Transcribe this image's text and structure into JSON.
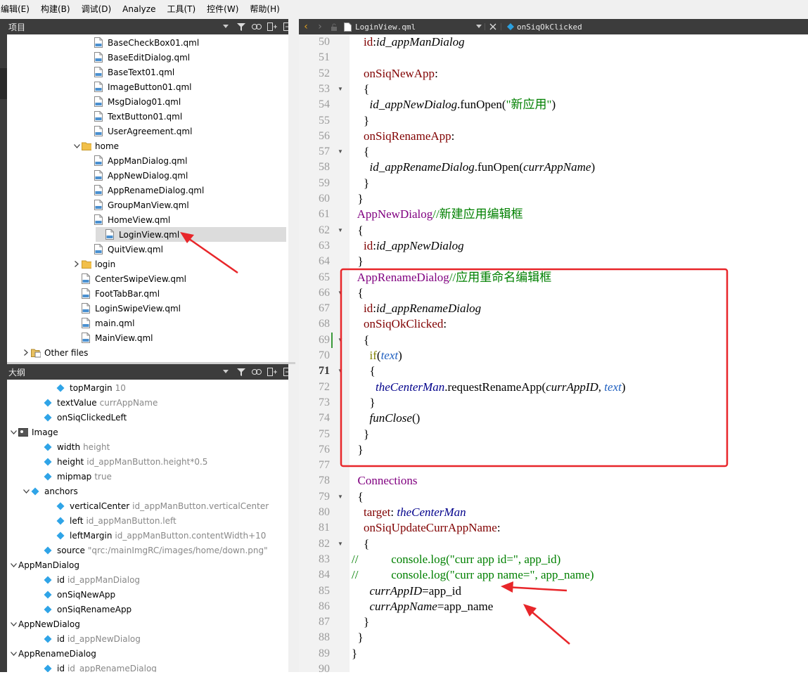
{
  "menu": [
    "编辑(E)",
    "构建(B)",
    "调试(D)",
    "Analyze",
    "工具(T)",
    "控件(W)",
    "帮助(H)"
  ],
  "project_panel": {
    "title": "项目",
    "rows": [
      {
        "indent": 6,
        "type": "qml",
        "label": "BaseCheckBox01.qml"
      },
      {
        "indent": 6,
        "type": "qml",
        "label": "BaseEditDialog.qml"
      },
      {
        "indent": 6,
        "type": "qml",
        "label": "BaseText01.qml"
      },
      {
        "indent": 6,
        "type": "qml",
        "label": "ImageButton01.qml"
      },
      {
        "indent": 6,
        "type": "qml",
        "label": "MsgDialog01.qml"
      },
      {
        "indent": 6,
        "type": "qml",
        "label": "TextButton01.qml"
      },
      {
        "indent": 6,
        "type": "qml",
        "label": "UserAgreement.qml"
      },
      {
        "indent": 5,
        "type": "folder",
        "arrow": "down",
        "label": "home"
      },
      {
        "indent": 6,
        "type": "qml",
        "label": "AppManDialog.qml"
      },
      {
        "indent": 6,
        "type": "qml",
        "label": "AppNewDialog.qml"
      },
      {
        "indent": 6,
        "type": "qml",
        "label": "AppRenameDialog.qml"
      },
      {
        "indent": 6,
        "type": "qml",
        "label": "GroupManView.qml"
      },
      {
        "indent": 6,
        "type": "qml",
        "label": "HomeView.qml"
      },
      {
        "indent": 6,
        "type": "qml",
        "label": "LoginView.qml",
        "selected": true
      },
      {
        "indent": 6,
        "type": "qml",
        "label": "QuitView.qml"
      },
      {
        "indent": 5,
        "type": "folder",
        "arrow": "right",
        "label": "login"
      },
      {
        "indent": 5,
        "type": "qml",
        "label": "CenterSwipeView.qml"
      },
      {
        "indent": 5,
        "type": "qml",
        "label": "FootTabBar.qml"
      },
      {
        "indent": 5,
        "type": "qml",
        "label": "LoginSwipeView.qml"
      },
      {
        "indent": 5,
        "type": "qml",
        "label": "main.qml"
      },
      {
        "indent": 5,
        "type": "qml",
        "label": "MainView.qml"
      },
      {
        "indent": 1,
        "type": "other",
        "arrow": "right",
        "label": "Other files"
      }
    ]
  },
  "outline_panel": {
    "title": "大纲",
    "rows": [
      {
        "indent": 3,
        "type": "prop",
        "label": "topMargin",
        "value": "10"
      },
      {
        "indent": 2,
        "type": "prop",
        "label": "textValue",
        "value": "currAppName"
      },
      {
        "indent": 2,
        "type": "prop",
        "label": "onSiqClickedLeft",
        "value": ""
      },
      {
        "indent": 0,
        "type": "image",
        "arrow": "down",
        "label": "Image",
        "value": ""
      },
      {
        "indent": 2,
        "type": "prop",
        "label": "width",
        "value": "height"
      },
      {
        "indent": 2,
        "type": "prop",
        "label": "height",
        "value": "id_appManButton.height*0.5"
      },
      {
        "indent": 2,
        "type": "prop",
        "label": "mipmap",
        "value": "true"
      },
      {
        "indent": 1,
        "type": "prop",
        "arrow": "down",
        "label": "anchors",
        "value": ""
      },
      {
        "indent": 3,
        "type": "prop",
        "label": "verticalCenter",
        "value": "id_appManButton.verticalCenter"
      },
      {
        "indent": 3,
        "type": "prop",
        "label": "left",
        "value": "id_appManButton.left"
      },
      {
        "indent": 3,
        "type": "prop",
        "label": "leftMargin",
        "value": "id_appManButton.contentWidth+10"
      },
      {
        "indent": 2,
        "type": "prop",
        "label": "source",
        "value": "\"qrc:/mainImgRC/images/home/down.png\""
      },
      {
        "indent": 0,
        "type": "none",
        "arrow": "down",
        "label": "AppManDialog",
        "value": ""
      },
      {
        "indent": 2,
        "type": "prop",
        "label": "id",
        "value": "id_appManDialog"
      },
      {
        "indent": 2,
        "type": "prop",
        "label": "onSiqNewApp",
        "value": ""
      },
      {
        "indent": 2,
        "type": "prop",
        "label": "onSiqRenameApp",
        "value": ""
      },
      {
        "indent": 0,
        "type": "none",
        "arrow": "down",
        "label": "AppNewDialog",
        "value": ""
      },
      {
        "indent": 2,
        "type": "prop",
        "label": "id",
        "value": "id_appNewDialog"
      },
      {
        "indent": 0,
        "type": "none",
        "arrow": "down",
        "label": "AppRenameDialog",
        "value": ""
      },
      {
        "indent": 2,
        "type": "prop",
        "label": "id",
        "value": "id_appRenameDialog"
      }
    ]
  },
  "editor": {
    "file_name": "LoginView.qml",
    "symbol": "onSiqOkClicked",
    "current_line": 71,
    "lines": [
      {
        "n": "50",
        "fold": "",
        "tokens": [
          [
            "",
            "    "
          ],
          [
            "pr",
            "id"
          ],
          [
            "",
            ":"
          ],
          [
            "it",
            "id_appManDialog"
          ]
        ]
      },
      {
        "n": "51",
        "fold": "",
        "tokens": []
      },
      {
        "n": "52",
        "fold": "",
        "tokens": [
          [
            "",
            "    "
          ],
          [
            "pr",
            "onSiqNewApp"
          ],
          [
            "",
            ":"
          ]
        ]
      },
      {
        "n": "53",
        "fold": "▼",
        "tokens": [
          [
            "",
            "    {"
          ]
        ]
      },
      {
        "n": "54",
        "fold": "",
        "tokens": [
          [
            "",
            "      "
          ],
          [
            "it",
            "id_appNewDialog"
          ],
          [
            "",
            ".funOpen("
          ],
          [
            "st",
            "\"新应用\""
          ],
          [
            "",
            ")"
          ]
        ]
      },
      {
        "n": "55",
        "fold": "",
        "tokens": [
          [
            "",
            "    }"
          ]
        ]
      },
      {
        "n": "56",
        "fold": "",
        "tokens": [
          [
            "",
            "    "
          ],
          [
            "pr",
            "onSiqRenameApp"
          ],
          [
            "",
            ":"
          ]
        ]
      },
      {
        "n": "57",
        "fold": "▼",
        "tokens": [
          [
            "",
            "    {"
          ]
        ]
      },
      {
        "n": "58",
        "fold": "",
        "tokens": [
          [
            "",
            "      "
          ],
          [
            "it",
            "id_appRenameDialog"
          ],
          [
            "",
            ".funOpen("
          ],
          [
            "it",
            "currAppName"
          ],
          [
            "",
            ")"
          ]
        ]
      },
      {
        "n": "59",
        "fold": "",
        "tokens": [
          [
            "",
            "    }"
          ]
        ]
      },
      {
        "n": "60",
        "fold": "",
        "tokens": [
          [
            "",
            "  }"
          ]
        ]
      },
      {
        "n": "61",
        "fold": "",
        "tokens": [
          [
            "",
            "  "
          ],
          [
            "kw",
            "AppNewDialog"
          ],
          [
            "cm",
            "//新建应用编辑框"
          ]
        ]
      },
      {
        "n": "62",
        "fold": "▼",
        "tokens": [
          [
            "",
            "  {"
          ]
        ]
      },
      {
        "n": "63",
        "fold": "",
        "tokens": [
          [
            "",
            "    "
          ],
          [
            "pr",
            "id"
          ],
          [
            "",
            ":"
          ],
          [
            "it",
            "id_appNewDialog"
          ]
        ]
      },
      {
        "n": "64",
        "fold": "",
        "tokens": [
          [
            "",
            "  }"
          ]
        ]
      },
      {
        "n": "65",
        "fold": "",
        "tokens": [
          [
            "",
            "  "
          ],
          [
            "kw",
            "AppRenameDialog"
          ],
          [
            "cm",
            "//应用重命名编辑框"
          ]
        ]
      },
      {
        "n": "66",
        "fold": "▼",
        "tokens": [
          [
            "",
            "  {"
          ]
        ]
      },
      {
        "n": "67",
        "fold": "",
        "tokens": [
          [
            "",
            "    "
          ],
          [
            "pr",
            "id"
          ],
          [
            "",
            ":"
          ],
          [
            "it",
            "id_appRenameDialog"
          ]
        ]
      },
      {
        "n": "68",
        "fold": "",
        "tokens": [
          [
            "",
            "    "
          ],
          [
            "pr",
            "onSiqOkClicked"
          ],
          [
            "",
            ":"
          ]
        ]
      },
      {
        "n": "69",
        "fold": "▼",
        "tokens": [
          [
            "",
            "    {"
          ]
        ]
      },
      {
        "n": "70",
        "fold": "",
        "tokens": [
          [
            "",
            "      "
          ],
          [
            "gl",
            "if"
          ],
          [
            "",
            "("
          ],
          [
            "lb",
            "text"
          ],
          [
            "",
            ")"
          ]
        ]
      },
      {
        "n": "71",
        "fold": "▼",
        "tokens": [
          [
            "",
            "      {"
          ]
        ]
      },
      {
        "n": "72",
        "fold": "",
        "tokens": [
          [
            "",
            "        "
          ],
          [
            "bl",
            "theCenterMan"
          ],
          [
            "",
            ".requestRenameApp("
          ],
          [
            "it",
            "currAppID"
          ],
          [
            "",
            ", "
          ],
          [
            "lb",
            "text"
          ],
          [
            "",
            ")"
          ]
        ]
      },
      {
        "n": "73",
        "fold": "",
        "tokens": [
          [
            "",
            "      }"
          ]
        ]
      },
      {
        "n": "74",
        "fold": "",
        "tokens": [
          [
            "",
            "      "
          ],
          [
            "it",
            "funClose"
          ],
          [
            "",
            "()"
          ]
        ]
      },
      {
        "n": "75",
        "fold": "",
        "tokens": [
          [
            "",
            "    }"
          ]
        ]
      },
      {
        "n": "76",
        "fold": "",
        "tokens": [
          [
            "",
            "  }"
          ]
        ]
      },
      {
        "n": "77",
        "fold": "",
        "tokens": []
      },
      {
        "n": "78",
        "fold": "",
        "tokens": [
          [
            "",
            "  "
          ],
          [
            "kw",
            "Connections"
          ]
        ]
      },
      {
        "n": "79",
        "fold": "▼",
        "tokens": [
          [
            "",
            "  {"
          ]
        ]
      },
      {
        "n": "80",
        "fold": "",
        "tokens": [
          [
            "",
            "    "
          ],
          [
            "pr",
            "target"
          ],
          [
            "",
            ": "
          ],
          [
            "bl",
            "theCenterMan"
          ]
        ]
      },
      {
        "n": "81",
        "fold": "",
        "tokens": [
          [
            "",
            "    "
          ],
          [
            "pr",
            "onSiqUpdateCurrAppName"
          ],
          [
            "",
            ":"
          ]
        ]
      },
      {
        "n": "82",
        "fold": "▼",
        "tokens": [
          [
            "",
            "    {"
          ]
        ]
      },
      {
        "n": "83",
        "fold": "",
        "tokens": [
          [
            "cm",
            "//           console.log(\"curr app id=\", app_id)"
          ]
        ]
      },
      {
        "n": "84",
        "fold": "",
        "tokens": [
          [
            "cm",
            "//           console.log(\"curr app name=\", app_name)"
          ]
        ]
      },
      {
        "n": "85",
        "fold": "",
        "tokens": [
          [
            "",
            "      "
          ],
          [
            "it",
            "currAppID"
          ],
          [
            "",
            "=app_id"
          ]
        ]
      },
      {
        "n": "86",
        "fold": "",
        "tokens": [
          [
            "",
            "      "
          ],
          [
            "it",
            "currAppName"
          ],
          [
            "",
            "=app_name"
          ]
        ]
      },
      {
        "n": "87",
        "fold": "",
        "tokens": [
          [
            "",
            "    }"
          ]
        ]
      },
      {
        "n": "88",
        "fold": "",
        "tokens": [
          [
            "",
            "  }"
          ]
        ]
      },
      {
        "n": "89",
        "fold": "",
        "tokens": [
          [
            "",
            "}"
          ]
        ]
      },
      {
        "n": "90",
        "fold": "",
        "tokens": []
      }
    ]
  },
  "colors": {
    "annotation_red": "#e8262a",
    "dark_bar": "#3c3c3c",
    "selection": "#dcdcdc"
  }
}
